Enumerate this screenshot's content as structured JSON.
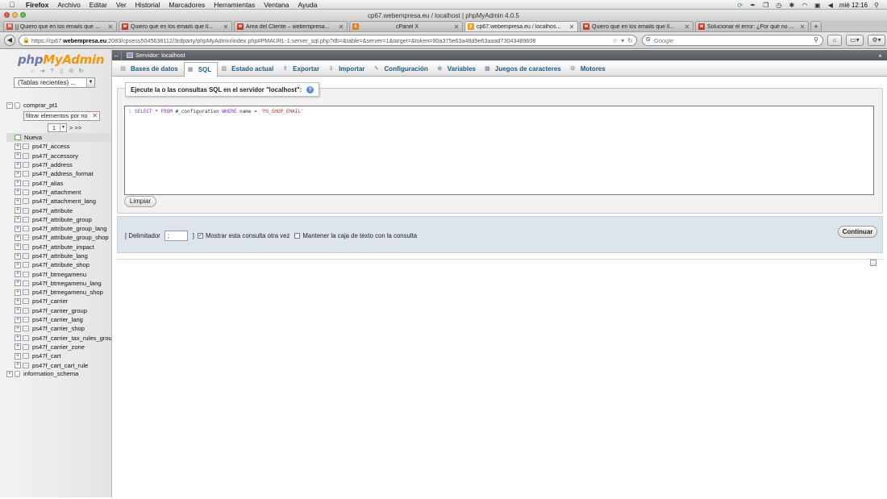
{
  "menubar": {
    "app": "Firefox",
    "items": [
      "Archivo",
      "Editar",
      "Ver",
      "Historial",
      "Marcadores",
      "Herramientas",
      "Ventana",
      "Ayuda"
    ],
    "clock": "mié 12:16"
  },
  "window": {
    "title": "cp67.webempresa.eu / localhost | phpMyAdmin 4.0.5"
  },
  "tabs": [
    {
      "title": "[] Quiero que en los emails que ...",
      "fav": "M",
      "color": "#d14b3a"
    },
    {
      "title": "Quiero que en los emails que ll...",
      "fav": "w",
      "color": "#c0392b"
    },
    {
      "title": "Área del Cliente – webempresa...",
      "fav": "w",
      "color": "#c0392b"
    },
    {
      "title": "cPanel X",
      "fav": "c",
      "color": "#e67e22"
    },
    {
      "title": "cp67.webempresa.eu / localhos...",
      "fav": "p",
      "color": "#f39c12"
    },
    {
      "title": "Quiero que en los emails que ll...",
      "fav": "w",
      "color": "#c0392b"
    },
    {
      "title": "Solucionar el error: ¿Por qué no ...",
      "fav": "w",
      "color": "#c0392b"
    }
  ],
  "url": {
    "prefix": "https://cp67.",
    "host": "webempresa.eu",
    "suffix": ":2083/cpsess5045638112/3rdparty/phpMyAdmin/index.php#PMAURL-1:server_sql.php?db=&table=&server=1&target=&token=90a375e63a48d9e63aaad73043489608"
  },
  "search": {
    "placeholder": "Google"
  },
  "sidebar": {
    "logo_php": "php",
    "logo_myadmin": "MyAdmin",
    "recent": "(Tablas recientes) ...",
    "db_name": "comprar_pt1",
    "filter_value": "filtrar elementos por no",
    "page_value": "1",
    "page_next": "> >>",
    "new_label": "Nueva",
    "tables": [
      "ps47f_access",
      "ps47f_accessory",
      "ps47f_address",
      "ps47f_address_format",
      "ps47f_alias",
      "ps47f_attachment",
      "ps47f_attachment_lang",
      "ps47f_attribute",
      "ps47f_attribute_group",
      "ps47f_attribute_group_lang",
      "ps47f_attribute_group_shop",
      "ps47f_attribute_impact",
      "ps47f_attribute_lang",
      "ps47f_attribute_shop",
      "ps47f_btmegamenu",
      "ps47f_btmegamenu_lang",
      "ps47f_btmegamenu_shop",
      "ps47f_carrier",
      "ps47f_carrier_group",
      "ps47f_carrier_lang",
      "ps47f_carrier_shop",
      "ps47f_carrier_tax_rules_group_shop",
      "ps47f_carrier_zone",
      "ps47f_cart",
      "ps47f_cart_cart_rule"
    ],
    "other_db": "information_schema"
  },
  "server_label": "Servidor: localhost",
  "topmenu": [
    {
      "label": "Bases de datos",
      "icon": "▤"
    },
    {
      "label": "SQL",
      "icon": "▦"
    },
    {
      "label": "Estado actual",
      "icon": "▥"
    },
    {
      "label": "Exportar",
      "icon": "⇪"
    },
    {
      "label": "Importar",
      "icon": "⇩"
    },
    {
      "label": "Configuración",
      "icon": "✎"
    },
    {
      "label": "Variables",
      "icon": "⊕"
    },
    {
      "label": "Juegos de caracteres",
      "icon": "▩"
    },
    {
      "label": "Motores",
      "icon": "⚙"
    }
  ],
  "sql": {
    "legend": "Ejecute la o las consultas SQL en el servidor \"localhost\":",
    "line_no": "1",
    "kw_select": "SELECT",
    "star": " * ",
    "kw_from": "FROM",
    "table": " #_configuration ",
    "kw_where": "WHERE",
    "cond": " name = ",
    "str": "'PS_SHOP_EMAIL'",
    "clear_label": "Limpiar"
  },
  "options": {
    "delim_label": "[ Delimitador",
    "delim_value": ";",
    "bracket_close": "]",
    "show_again_label": "Mostrar esta consulta otra vez",
    "keep_box_label": "Mantener la caja de texto con la consulta",
    "go_label": "Continuar"
  }
}
